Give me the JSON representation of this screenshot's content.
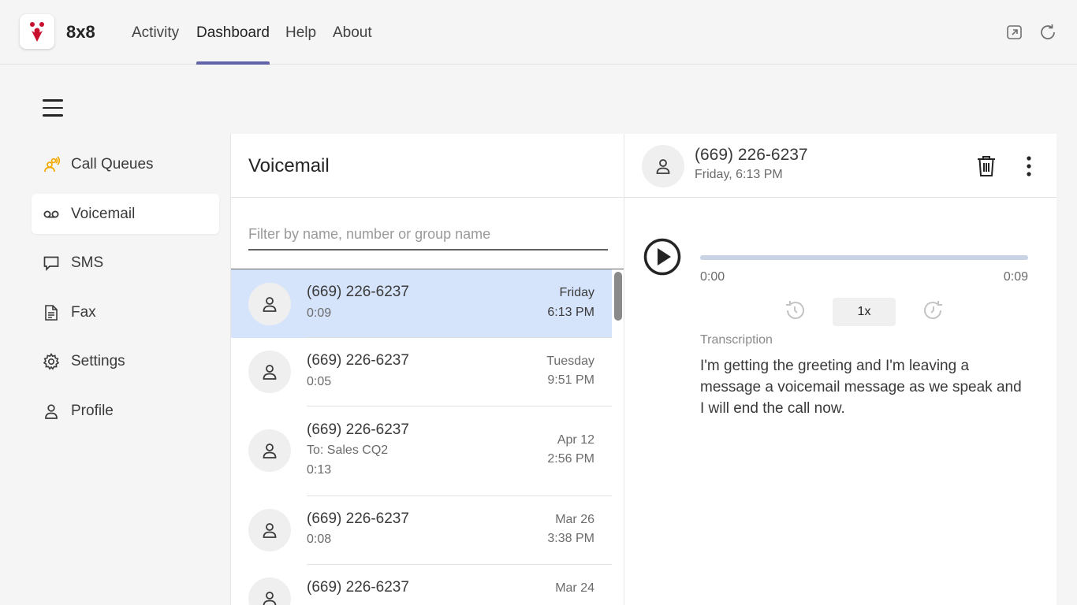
{
  "app": {
    "name": "8x8",
    "tabs": [
      {
        "label": "Activity"
      },
      {
        "label": "Dashboard"
      },
      {
        "label": "Help"
      },
      {
        "label": "About"
      }
    ],
    "active_tab": "Dashboard",
    "icons": [
      "popout-icon",
      "refresh-icon"
    ]
  },
  "colors": {
    "accent": "#6264a7",
    "brand_red": "#c8102e",
    "selected_row": "#d6e4fb",
    "call_queues_icon": "#f2a900"
  },
  "sidebar": {
    "items": [
      {
        "label": "Call Queues",
        "icon": "call-queues-icon"
      },
      {
        "label": "Voicemail",
        "icon": "voicemail-icon",
        "active": true
      },
      {
        "label": "SMS",
        "icon": "sms-icon"
      },
      {
        "label": "Fax",
        "icon": "fax-icon"
      },
      {
        "label": "Settings",
        "icon": "gear-icon"
      },
      {
        "label": "Profile",
        "icon": "person-icon"
      }
    ]
  },
  "list": {
    "title": "Voicemail",
    "filter_placeholder": "Filter by name, number or group name",
    "items": [
      {
        "number": "(669) 226-6237",
        "duration": "0:09",
        "day": "Friday",
        "time": "6:13 PM",
        "selected": true
      },
      {
        "number": "(669) 226-6237",
        "duration": "0:05",
        "day": "Tuesday",
        "time": "9:51 PM"
      },
      {
        "number": "(669) 226-6237",
        "to": "To: Sales CQ2",
        "duration": "0:13",
        "day": "Apr 12",
        "time": "2:56 PM"
      },
      {
        "number": "(669) 226-6237",
        "duration": "0:08",
        "day": "Mar 26",
        "time": "3:38 PM"
      },
      {
        "number": "(669) 226-6237",
        "duration": "",
        "day": "Mar 24",
        "time": ""
      }
    ]
  },
  "detail": {
    "number": "(669) 226-6237",
    "date": "Friday, 6:13 PM",
    "player": {
      "current_time": "0:00",
      "total_time": "0:09",
      "progress": 0,
      "speed": "1x"
    },
    "transcription_label": "Transcription",
    "transcription": "I'm getting the greeting and I'm leaving a message a voicemail message as we speak and I will end the call now."
  }
}
